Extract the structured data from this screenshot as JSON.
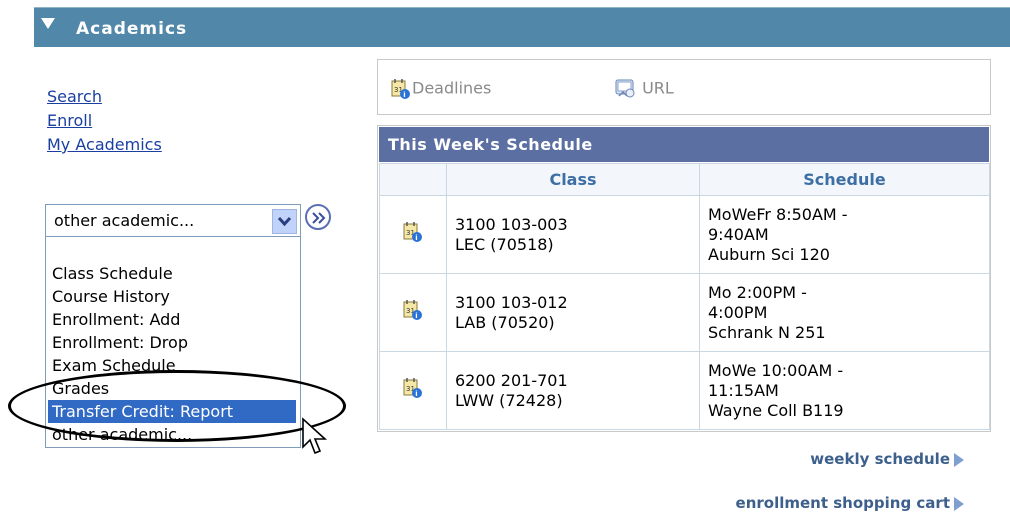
{
  "header": {
    "title": "Academics"
  },
  "left_links": [
    "Search",
    "Enroll",
    "My Academics"
  ],
  "select": {
    "value": "other academic..."
  },
  "dropdown_options": [
    "Class Schedule",
    "Course History",
    "Enrollment: Add",
    "Enrollment: Drop",
    "Exam Schedule",
    "Grades",
    "Transfer Credit: Report",
    "other academic..."
  ],
  "highlighted_option": "Transfer Credit: Report",
  "top_links": {
    "deadlines": "Deadlines",
    "url": "URL"
  },
  "schedule": {
    "title": "This Week's Schedule",
    "headers": [
      "Class",
      "Schedule"
    ],
    "rows": [
      {
        "class_line1": "3100 103-003",
        "class_line2": "LEC (70518)",
        "sched_line1": "MoWeFr 8:50AM -",
        "sched_line2": "9:40AM",
        "sched_line3": "Auburn Sci 120"
      },
      {
        "class_line1": "3100 103-012",
        "class_line2": "LAB (70520)",
        "sched_line1": "Mo 2:00PM -",
        "sched_line2": "4:00PM",
        "sched_line3": "Schrank N 251"
      },
      {
        "class_line1": "6200 201-701",
        "class_line2": "LWW (72428)",
        "sched_line1": "MoWe 10:00AM -",
        "sched_line2": "11:15AM",
        "sched_line3": "Wayne Coll B119"
      }
    ]
  },
  "bottom_links": {
    "weekly": "weekly schedule",
    "cart": "enrollment shopping cart"
  },
  "colors": {
    "header_bg": "#5187a9",
    "caption_bg": "#5b6fa2",
    "highlight": "#316ac5",
    "link": "#1a3fa0"
  }
}
